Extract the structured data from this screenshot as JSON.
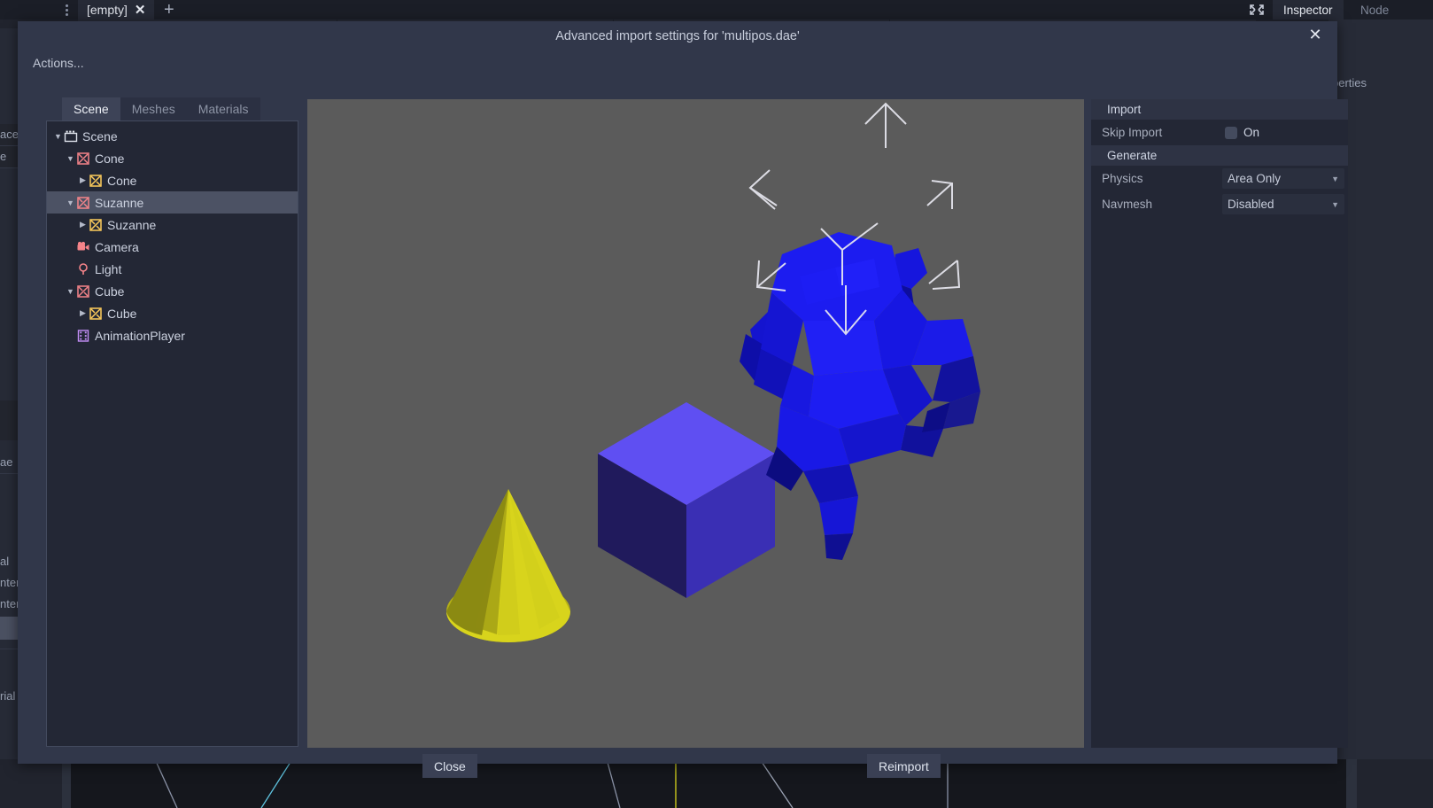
{
  "background": {
    "tab_label": "[empty]",
    "tab_close": "✕",
    "add_tab": "+",
    "inspector_tab": "Inspector",
    "node_tab": "Node",
    "left_fragments": [
      "ace",
      "e",
      "ae",
      "al",
      "nter",
      "nter",
      "rial"
    ],
    "right_fragments": [
      "perties"
    ]
  },
  "dialog": {
    "title": "Advanced import settings for 'multipos.dae'",
    "close_label": "✕",
    "actions_label": "Actions...",
    "tabs": [
      {
        "label": "Scene",
        "active": true
      },
      {
        "label": "Meshes",
        "active": false
      },
      {
        "label": "Materials",
        "active": false
      }
    ],
    "footer": {
      "close_label": "Close",
      "reimport_label": "Reimport"
    }
  },
  "scene_tree": {
    "nodes": [
      {
        "label": "Scene",
        "depth": 0,
        "icon": "scene-icon",
        "arrow": "down",
        "selected": false
      },
      {
        "label": "Cone",
        "depth": 1,
        "icon": "mesh-instance-icon",
        "arrow": "down",
        "selected": false
      },
      {
        "label": "Cone",
        "depth": 2,
        "icon": "mesh-icon",
        "arrow": "right",
        "selected": false
      },
      {
        "label": "Suzanne",
        "depth": 1,
        "icon": "mesh-instance-icon",
        "arrow": "down",
        "selected": true
      },
      {
        "label": "Suzanne",
        "depth": 2,
        "icon": "mesh-icon",
        "arrow": "right",
        "selected": false
      },
      {
        "label": "Camera",
        "depth": 1,
        "icon": "camera-icon",
        "arrow": "none",
        "selected": false
      },
      {
        "label": "Light",
        "depth": 1,
        "icon": "light-icon",
        "arrow": "none",
        "selected": false
      },
      {
        "label": "Cube",
        "depth": 1,
        "icon": "mesh-instance-icon",
        "arrow": "down",
        "selected": false
      },
      {
        "label": "Cube",
        "depth": 2,
        "icon": "mesh-icon",
        "arrow": "right",
        "selected": false
      },
      {
        "label": "AnimationPlayer",
        "depth": 1,
        "icon": "animation-player-icon",
        "arrow": "none",
        "selected": false
      }
    ]
  },
  "inspector": {
    "sections": [
      {
        "title": "Import",
        "rows": [
          {
            "label": "Skip Import",
            "type": "checkbox",
            "value": "On",
            "checked": false
          }
        ]
      },
      {
        "title": "Generate",
        "rows": [
          {
            "label": "Physics",
            "type": "select",
            "value": "Area Only"
          },
          {
            "label": "Navmesh",
            "type": "select",
            "value": "Disabled"
          }
        ]
      }
    ]
  },
  "viewport": {
    "background_color": "#5b5b5b",
    "objects": [
      {
        "name": "cone",
        "color": "#d8d41c"
      },
      {
        "name": "cube",
        "color": "#5a4bf0"
      },
      {
        "name": "suzanne",
        "color": "#1313e6",
        "selected": true
      }
    ],
    "selection_gizmo": "bounding-box-arrows"
  }
}
